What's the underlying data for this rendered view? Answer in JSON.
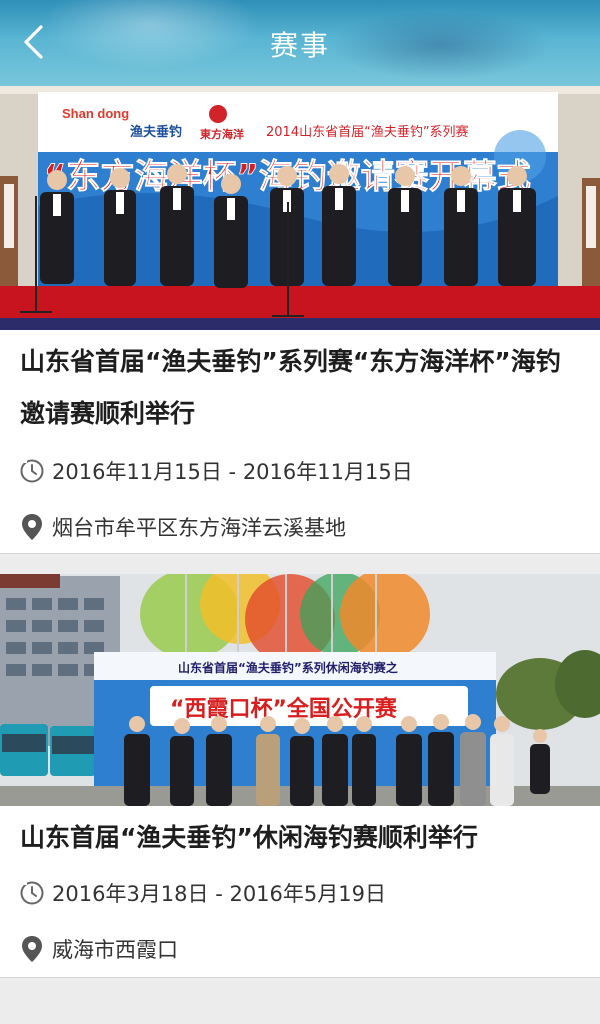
{
  "header": {
    "title": "赛事"
  },
  "events": [
    {
      "title": "山东省首届“渔夫垂钓”系列赛“东方海洋杯”海钓邀请赛顺利举行",
      "date": "2016年11月15日 - 2016年11月15日",
      "location": "烟台市牟平区东方海洋云溪基地",
      "banner": {
        "brand_1": "Shan dong",
        "brand_2": "渔夫垂钓",
        "brand_3": "東方海洋",
        "series": "2014山东省首届“渔夫垂钓”系列赛",
        "headline": "“东方海洋杯”海钓邀请赛开幕式"
      }
    },
    {
      "title": "山东首届“渔夫垂钓”休闲海钓赛顺利举行",
      "date": "2016年3月18日 - 2016年5月19日",
      "location": "威海市西霞口",
      "banner": {
        "series": "山东省首届“渔夫垂钓”系列休闲海钓赛之",
        "headline": "“西霞口杯”全国公开赛"
      }
    }
  ],
  "icons": {
    "back": "chevron-left-icon",
    "date": "clock-icon",
    "location": "map-pin-icon"
  },
  "colors": {
    "header_top": "#2f8fb8",
    "header_bottom": "#79c6db",
    "banner_blue": "#2e7fd0",
    "headline_red": "#d81e1e",
    "carpet_red": "#c8141e"
  }
}
